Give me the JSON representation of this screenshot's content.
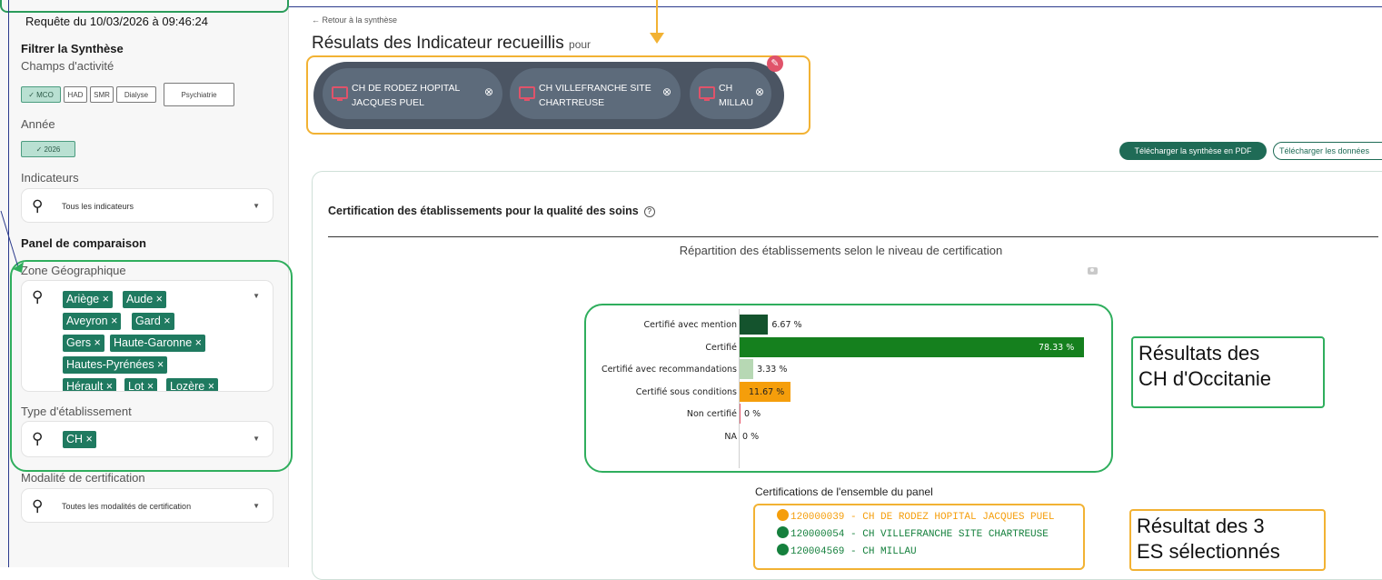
{
  "sidebar": {
    "request_date": "Requête du 10/03/2026 à 09:46:24",
    "filter_title": "Filtrer la Synthèse",
    "activity_label": "Champs d'activité",
    "activity_chips": [
      {
        "label": "✓ MCO",
        "selected": true
      },
      {
        "label": "HAD",
        "selected": false
      },
      {
        "label": "SMR",
        "selected": false
      },
      {
        "label": "Dialyse",
        "selected": false
      },
      {
        "label": "Psychiatrie",
        "selected": false
      }
    ],
    "year_label": "Année",
    "year_chip": "✓ 2026",
    "indicators_label": "Indicateurs",
    "indicators_placeholder": "Tous les indicateurs",
    "panel_title": "Panel de comparaison",
    "geo_label": "Zone Géographique",
    "geo_tags": [
      "Ariège ×",
      "Aude ×",
      "Aveyron ×",
      "Gard ×",
      "Gers ×",
      "Haute-Garonne ×",
      "Hautes-Pyrénées ×",
      "Hérault ×",
      "Lot ×",
      "Lozère ×"
    ],
    "type_label": "Type d'établissement",
    "type_tag": "CH ×",
    "certif_label": "Modalité de certification",
    "certif_placeholder": "Toutes les modalités de certification"
  },
  "main": {
    "back_link": "← Retour à la synthèse",
    "title": "Résulats des Indicateur recueillis",
    "title_suffix": "pour",
    "establishments": [
      {
        "line1": "CH DE RODEZ HOPITAL",
        "line2": "JACQUES PUEL"
      },
      {
        "line1": "CH VILLEFRANCHE SITE",
        "line2": "CHARTREUSE"
      },
      {
        "line1": "CH",
        "line2": "MILLAU"
      }
    ],
    "remove_symbol": "⊗",
    "edit_symbol": "✎",
    "download_pdf": "Télécharger la synthèse en PDF",
    "download_data": "Télécharger les données",
    "section_title": "Certification des établissements pour la qualité des soins",
    "help_symbol": "?",
    "panel_legend_title": "Certifications de l'ensemble du panel",
    "panel_items": [
      {
        "text": "120000039 - CH DE RODEZ HOPITAL JACQUES PUEL",
        "color": "#f59e0b"
      },
      {
        "text": "120000054 - CH VILLEFRANCHE SITE CHARTREUSE",
        "color": "#15803d"
      },
      {
        "text": "120004569 - CH MILLAU",
        "color": "#15803d"
      }
    ]
  },
  "annotations": {
    "callout_occitanie_1": "Résultats des",
    "callout_occitanie_2": "CH d'Occitanie",
    "callout_selected_1": "Résultat des 3",
    "callout_selected_2": "ES sélectionnés"
  },
  "chart_data": {
    "type": "bar",
    "orientation": "horizontal",
    "title": "Répartition des établissements selon le niveau de certification",
    "categories": [
      "Certifié avec mention",
      "Certifié",
      "Certifié avec recommandations",
      "Certifié sous conditions",
      "Non certifié",
      "NA"
    ],
    "values": [
      6.67,
      78.33,
      3.33,
      11.67,
      0,
      0
    ],
    "value_labels": [
      "6.67 %",
      "78.33 %",
      "3.33 %",
      "11.67 %",
      "0 %",
      "0 %"
    ],
    "colors": [
      "#14532d",
      "#15801e",
      "#b7d8b4",
      "#f59e0b",
      "#e55b6d",
      "#9aa0a6"
    ],
    "xlim": [
      0,
      80
    ]
  }
}
